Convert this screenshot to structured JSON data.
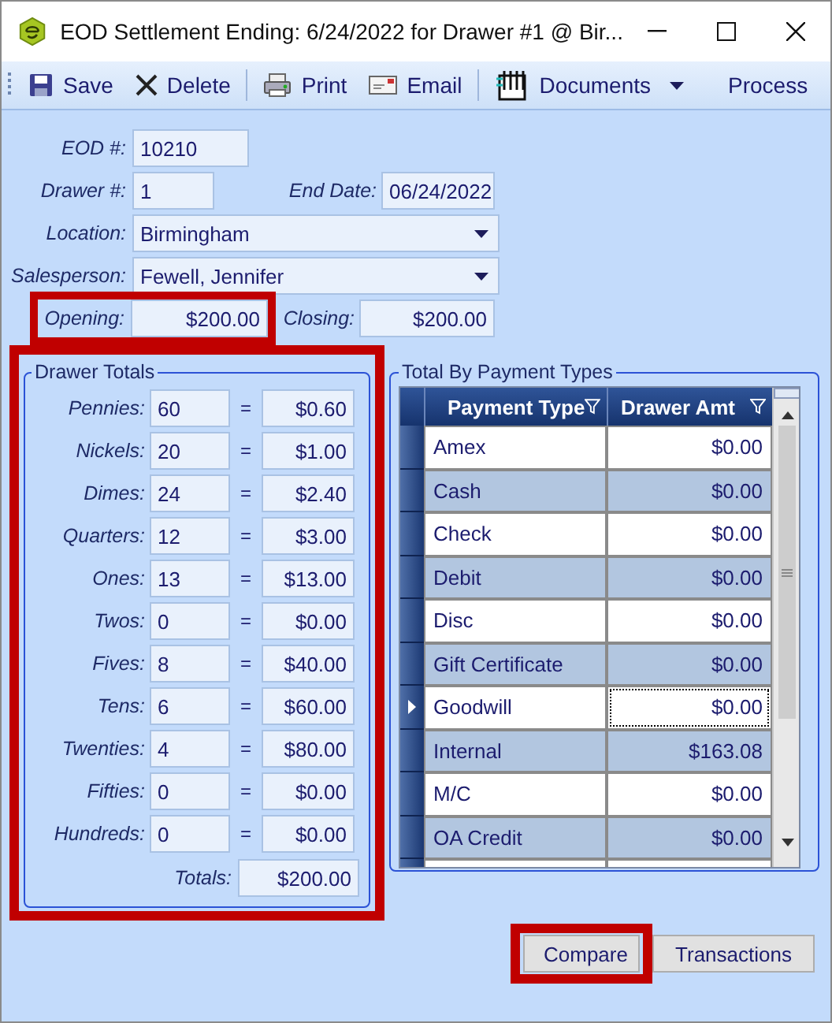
{
  "window": {
    "title": "EOD Settlement Ending: 6/24/2022 for Drawer #1 @ Bir..."
  },
  "toolbar": [
    {
      "kind": "save",
      "label": "Save"
    },
    {
      "kind": "delete",
      "label": "Delete"
    },
    {
      "kind": "separator"
    },
    {
      "kind": "print",
      "label": "Print"
    },
    {
      "kind": "email",
      "label": "Email"
    },
    {
      "kind": "separator"
    },
    {
      "kind": "documents",
      "label": "Documents"
    },
    {
      "kind": "process",
      "label": "Process"
    }
  ],
  "eod_number": {
    "label": "EOD #:",
    "value": "10210"
  },
  "drawer_number": {
    "label": "Drawer #:",
    "value": "1"
  },
  "end_date": {
    "label": "End Date:",
    "value": "06/24/2022"
  },
  "location": {
    "label": "Location:",
    "value": "Birmingham"
  },
  "salesperson": {
    "label": "Salesperson:",
    "value": "Fewell, Jennifer"
  },
  "opening": {
    "label": "Opening:",
    "value": "$200.00",
    "highlighted": true
  },
  "closing": {
    "label": "Closing:",
    "value": "$200.00"
  },
  "drawer_totals": {
    "title": "Drawer Totals",
    "highlighted": true,
    "rows": [
      {
        "label": "Pennies:",
        "count": "60",
        "equals": "=",
        "amount": "$0.60"
      },
      {
        "label": "Nickels:",
        "count": "20",
        "equals": "=",
        "amount": "$1.00"
      },
      {
        "label": "Dimes:",
        "count": "24",
        "equals": "=",
        "amount": "$2.40"
      },
      {
        "label": "Quarters:",
        "count": "12",
        "equals": "=",
        "amount": "$3.00"
      },
      {
        "label": "Ones:",
        "count": "13",
        "equals": "=",
        "amount": "$13.00"
      },
      {
        "label": "Twos:",
        "count": "0",
        "equals": "=",
        "amount": "$0.00"
      },
      {
        "label": "Fives:",
        "count": "8",
        "equals": "=",
        "amount": "$40.00"
      },
      {
        "label": "Tens:",
        "count": "6",
        "equals": "=",
        "amount": "$60.00"
      },
      {
        "label": "Twenties:",
        "count": "4",
        "equals": "=",
        "amount": "$80.00"
      },
      {
        "label": "Fifties:",
        "count": "0",
        "equals": "=",
        "amount": "$0.00"
      },
      {
        "label": "Hundreds:",
        "count": "0",
        "equals": "=",
        "amount": "$0.00"
      }
    ],
    "totals": {
      "label": "Totals:",
      "value": "$200.00"
    }
  },
  "payment_types": {
    "title": "Total By Payment Types",
    "columns": [
      "Payment Type",
      "Drawer Amt"
    ],
    "rows": [
      {
        "type": "Amex",
        "amount": "$0.00",
        "selected": false
      },
      {
        "type": "Cash",
        "amount": "$0.00",
        "selected": false
      },
      {
        "type": "Check",
        "amount": "$0.00",
        "selected": false
      },
      {
        "type": "Debit",
        "amount": "$0.00",
        "selected": false
      },
      {
        "type": "Disc",
        "amount": "$0.00",
        "selected": false
      },
      {
        "type": "Gift Certificate",
        "amount": "$0.00",
        "selected": false
      },
      {
        "type": "Goodwill",
        "amount": "$0.00",
        "selected": true
      },
      {
        "type": "Internal",
        "amount": "$163.08",
        "selected": false
      },
      {
        "type": "M/C",
        "amount": "$0.00",
        "selected": false
      },
      {
        "type": "OA Credit",
        "amount": "$0.00",
        "selected": false
      }
    ]
  },
  "buttons": [
    {
      "label": "Compare",
      "highlighted": true
    },
    {
      "label": "Transactions",
      "highlighted": false
    }
  ]
}
